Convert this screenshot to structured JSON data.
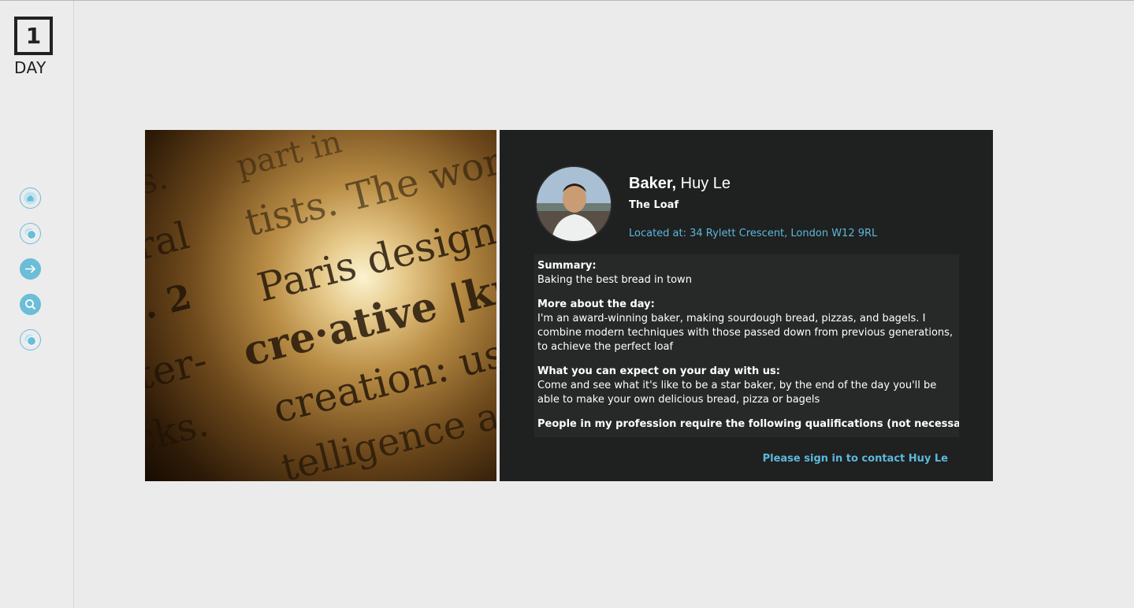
{
  "logo": {
    "number": "1",
    "word": "DAY"
  },
  "nav": [
    {
      "icon": "home-icon"
    },
    {
      "icon": "circles-icon"
    },
    {
      "icon": "arrow-right-icon"
    },
    {
      "icon": "search-icon"
    },
    {
      "icon": "circles-icon"
    }
  ],
  "hero_image": {
    "words": [
      "part in",
      "tists. The worn",
      "Paris designers",
      "cre·ative |kri",
      "creation: use",
      "telligence an",
      "ral",
      "s.",
      ". 2",
      "ter-",
      "cks."
    ]
  },
  "profile": {
    "role": "Baker,",
    "name": "Huy Le",
    "company": "The Loaf",
    "location": "Located at: 34 Rylett Crescent, London W12 9RL"
  },
  "details": {
    "summary_heading": "Summary:",
    "summary_text": "Baking the best bread in town",
    "more_heading": "More about the day:",
    "more_text": "I'm an award-winning baker, making sourdough bread, pizzas, and bagels. I combine modern techniques with those passed down from previous generations, to achieve the perfect loaf",
    "expect_heading": "What you can expect on your day with us:",
    "expect_text": "Come and see what it's like to be a star baker, by the end of the day you'll be able to make your own delicious bread, pizza or bagels",
    "qualifications_heading": "People in my profession require the following qualifications (not necessary"
  },
  "contact_link": "Please sign in to contact Huy Le",
  "colors": {
    "accent": "#5bb8dc",
    "card_bg": "#1f2020",
    "page_bg": "#ebebeb"
  }
}
